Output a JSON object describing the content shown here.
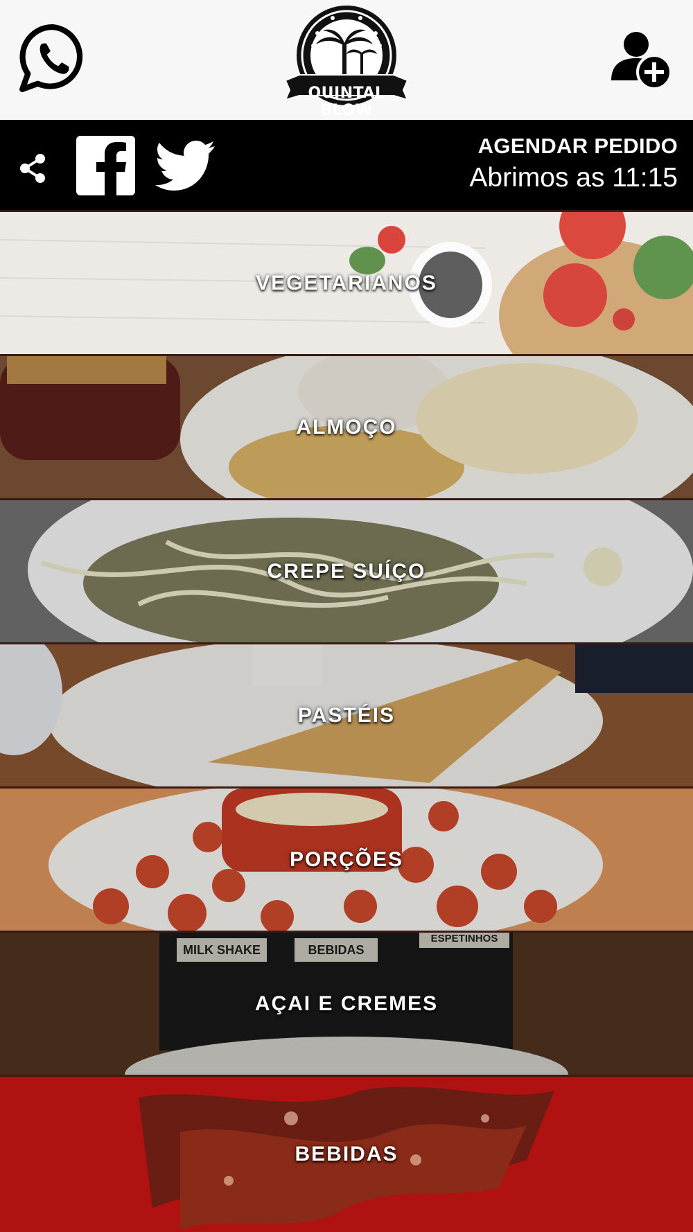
{
  "header": {
    "logo_text": "QUINTAL BLOW",
    "whatsapp_icon": "whatsapp-icon",
    "add_user_icon": "add-user-icon"
  },
  "social_bar": {
    "icons": [
      "share-icon",
      "facebook-icon",
      "twitter-icon"
    ],
    "schedule_label": "AGENDAR PEDIDO",
    "opening_text": "Abrimos as 11:15"
  },
  "categories": [
    {
      "label": "VEGETARIANOS"
    },
    {
      "label": "ALMOÇO"
    },
    {
      "label": "CREPE SUÍÇO"
    },
    {
      "label": "PASTÉIS"
    },
    {
      "label": "PORÇÕES"
    },
    {
      "label": "AÇAI E CREMES"
    },
    {
      "label": "BEBIDAS"
    }
  ],
  "background_photo_text": {
    "milk_shake": "MILK SHAKE",
    "bebidas": "BEBIDAS",
    "espetinhos": "ESPETINHOS"
  },
  "colors": {
    "topbar_bg": "#f7f7f7",
    "social_bar_bg": "#000000",
    "divider": "#3a1a12",
    "bebidas_bg": "#b01212"
  }
}
